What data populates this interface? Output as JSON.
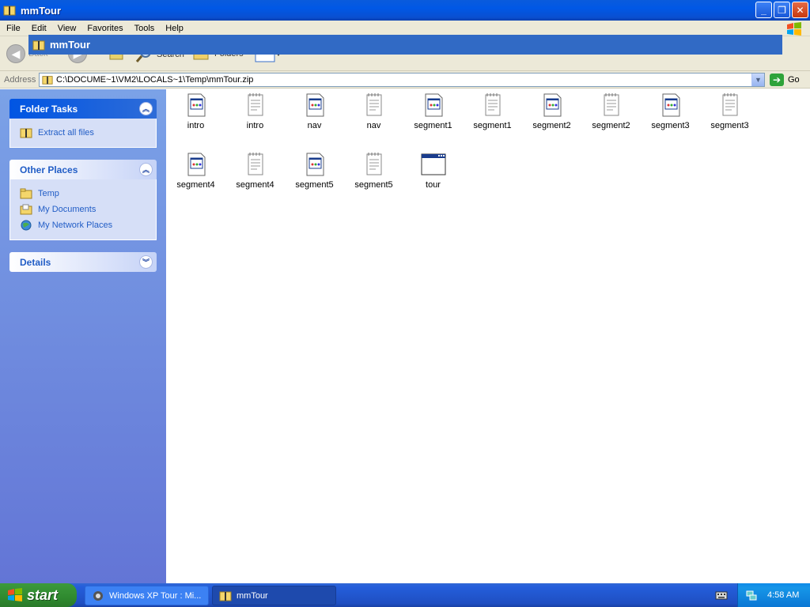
{
  "window": {
    "title": "mmTour",
    "minimize_icon": "minimize-icon",
    "restore_icon": "restore-icon",
    "close_icon": "close-icon"
  },
  "menu": {
    "items": [
      "File",
      "Edit",
      "View",
      "Favorites",
      "Tools",
      "Help"
    ]
  },
  "toolbar": {
    "back_label": "Back",
    "search_label": "Search",
    "folders_label": "Folders"
  },
  "dropdown": {
    "label": "mmTour"
  },
  "address": {
    "label": "Address",
    "value": "C:\\DOCUME~1\\VM2\\LOCALS~1\\Temp\\mmTour.zip",
    "go_label": "Go"
  },
  "left_pane": {
    "folder_tasks": {
      "title": "Folder Tasks",
      "items": [
        "Extract all files"
      ]
    },
    "other_places": {
      "title": "Other Places",
      "items": [
        "Temp",
        "My Documents",
        "My Network Places"
      ]
    },
    "details": {
      "title": "Details"
    }
  },
  "files": [
    {
      "name": "intro",
      "type": "html"
    },
    {
      "name": "intro",
      "type": "text"
    },
    {
      "name": "nav",
      "type": "html"
    },
    {
      "name": "nav",
      "type": "text"
    },
    {
      "name": "segment1",
      "type": "html"
    },
    {
      "name": "segment1",
      "type": "text"
    },
    {
      "name": "segment2",
      "type": "html"
    },
    {
      "name": "segment2",
      "type": "text"
    },
    {
      "name": "segment3",
      "type": "html"
    },
    {
      "name": "segment3",
      "type": "text"
    },
    {
      "name": "segment4",
      "type": "html"
    },
    {
      "name": "segment4",
      "type": "text"
    },
    {
      "name": "segment5",
      "type": "html"
    },
    {
      "name": "segment5",
      "type": "text"
    },
    {
      "name": "tour",
      "type": "app"
    }
  ],
  "taskbar": {
    "start_label": "start",
    "buttons": [
      "Windows XP Tour : Mi...",
      "mmTour"
    ],
    "clock": "4:58 AM"
  }
}
